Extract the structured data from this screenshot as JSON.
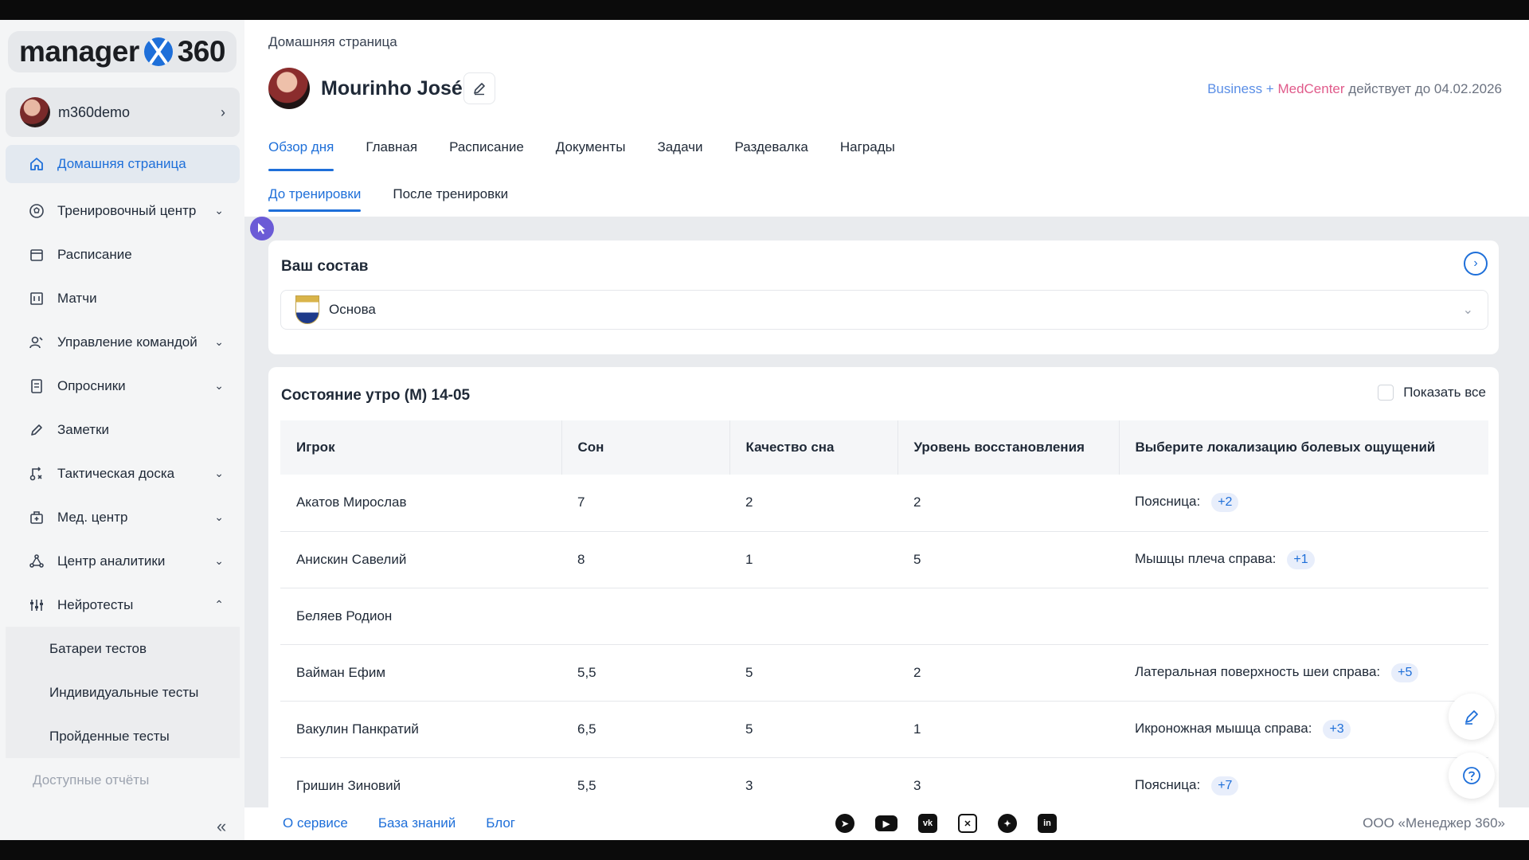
{
  "app": {
    "logo_text_left": "manager",
    "logo_text_right": "360"
  },
  "user": {
    "name": "m360demo"
  },
  "sidebar": {
    "items": [
      {
        "label": "Домашняя страница",
        "icon": "home-icon",
        "active": true
      },
      {
        "label": "Тренировочный центр",
        "icon": "ball-icon",
        "expandable": true
      },
      {
        "label": "Расписание",
        "icon": "calendar-icon"
      },
      {
        "label": "Матчи",
        "icon": "scoreboard-icon"
      },
      {
        "label": "Управление командой",
        "icon": "users-icon",
        "expandable": true
      },
      {
        "label": "Опросники",
        "icon": "survey-icon",
        "expandable": true
      },
      {
        "label": "Заметки",
        "icon": "pencil-icon"
      },
      {
        "label": "Тактическая доска",
        "icon": "tactics-icon",
        "expandable": true
      },
      {
        "label": "Мед. центр",
        "icon": "medical-icon",
        "expandable": true
      },
      {
        "label": "Центр аналитики",
        "icon": "analytics-icon",
        "expandable": true
      },
      {
        "label": "Нейротесты",
        "icon": "sliders-icon",
        "expanded": true
      }
    ],
    "subitems": [
      "Батареи тестов",
      "Индивидуальные тесты",
      "Пройденные тесты"
    ],
    "reports": "Доступные отчёты"
  },
  "header": {
    "breadcrumb": "Домашняя страница",
    "profile_name": "Mourinho José",
    "license_a": "Business",
    "license_plus": " + ",
    "license_b": "MedCenter",
    "license_rest": " действует до 04.02.2026",
    "tabs": [
      "Обзор дня",
      "Главная",
      "Расписание",
      "Документы",
      "Задачи",
      "Раздевалка",
      "Награды"
    ],
    "active_tab": "Обзор дня",
    "subtabs": [
      "До тренировки",
      "После тренировки"
    ],
    "active_subtab": "До тренировки"
  },
  "squad": {
    "title": "Ваш состав",
    "selected": "Основа"
  },
  "state": {
    "title": "Состояние утро (М) 14-05",
    "show_all_label": "Показать все",
    "columns": [
      "Игрок",
      "Сон",
      "Качество сна",
      "Уровень восстановления",
      "Выберите локализацию болевых ощущений"
    ],
    "rows": [
      {
        "player": "Акатов Мирослав",
        "sleep": "7",
        "quality": "2",
        "recovery": "2",
        "pain": "Поясница:",
        "extra": "+2"
      },
      {
        "player": "Анискин Савелий",
        "sleep": "8",
        "quality": "1",
        "recovery": "5",
        "pain": "Мышцы плеча справа:",
        "extra": "+1"
      },
      {
        "player": "Беляев Родион",
        "sleep": "",
        "quality": "",
        "recovery": "",
        "pain": "",
        "extra": ""
      },
      {
        "player": "Вайман Ефим",
        "sleep": "5,5",
        "quality": "5",
        "recovery": "2",
        "pain": "Латеральная поверхность шеи справа:",
        "extra": "+5"
      },
      {
        "player": "Вакулин Панкратий",
        "sleep": "6,5",
        "quality": "5",
        "recovery": "1",
        "pain": "Икроножная мышца справа:",
        "extra": "+3"
      },
      {
        "player": "Гришин Зиновий",
        "sleep": "5,5",
        "quality": "3",
        "recovery": "3",
        "pain": "Поясница:",
        "extra": "+7"
      }
    ]
  },
  "footer": {
    "links": [
      "О сервисе",
      "База знаний",
      "Блог"
    ],
    "company": "ООО «Менеджер 360»",
    "socials": [
      "telegram-icon",
      "youtube-icon",
      "vk-icon",
      "yandex-zen-icon",
      "plus-icon",
      "linkedin-icon"
    ]
  },
  "colors": {
    "accent": "#1e6fd9",
    "license_business": "#5a8ee6",
    "license_medcenter": "#e05a8a"
  }
}
